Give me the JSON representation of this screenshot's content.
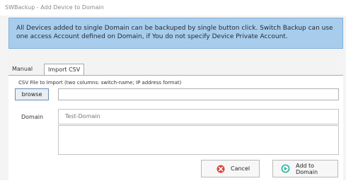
{
  "window": {
    "title": "SWBackup - Add Device to Domain"
  },
  "banner": {
    "text": "All Devices added to single Domain can be backuped by single button click. Switch Backup can use one access Account defined on Domain, if You do not specify Device Private Account."
  },
  "tabs": [
    {
      "label": "Manual",
      "active": false
    },
    {
      "label": "Import CSV",
      "active": true
    }
  ],
  "import_csv": {
    "file_label": "CSV File to Import (two columns: switch-name; IP address format)",
    "browse_label": "browse",
    "file_value": ""
  },
  "domain": {
    "label": "Domain",
    "value": "Test-Domain"
  },
  "description": {
    "value": ""
  },
  "buttons": {
    "cancel_label": "Cancel",
    "add_label": "Add to Domain"
  },
  "colors": {
    "banner_bg": "#a8cdec",
    "cancel_icon": "#d9443a",
    "add_icon": "#35b7a2"
  },
  "icons": {
    "cancel": "cancel-icon",
    "add": "add-icon"
  }
}
